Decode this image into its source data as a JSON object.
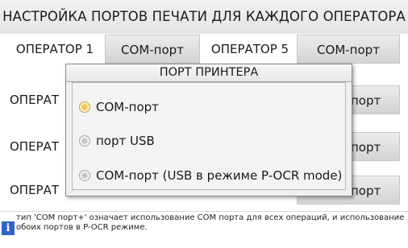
{
  "header": {
    "title": "НАСТРОЙКА ПОРТОВ ПЕЧАТИ ДЛЯ КАЖДОГО ОПЕРАТОРА"
  },
  "operators": [
    {
      "label": "ОПЕРАТОР 1",
      "port": "COM-порт"
    },
    {
      "label": "ОПЕРАТОР 5",
      "port": "COM-порт"
    },
    {
      "label": "ОПЕРАТ",
      "port": "порт"
    },
    {
      "label": "ОПЕРАТ",
      "port": "порт"
    },
    {
      "label": "ОПЕРАТ",
      "port": "порт"
    }
  ],
  "dialog": {
    "title": "ПОРТ ПРИНТЕРА",
    "options": [
      {
        "label": "COM-порт",
        "selected": true
      },
      {
        "label": "порт USB",
        "selected": false
      },
      {
        "label": "COM-порт (USB в режиме P-OCR mode)",
        "selected": false
      }
    ]
  },
  "footer": {
    "icon": "info-icon",
    "text": "тип 'COM порт+' означает использование COM порта для всех операций, и использование обоих портов в P-OCR режиме."
  },
  "colors": {
    "selected_radio": "#f2c44a",
    "info_icon": "#2f63c9"
  }
}
